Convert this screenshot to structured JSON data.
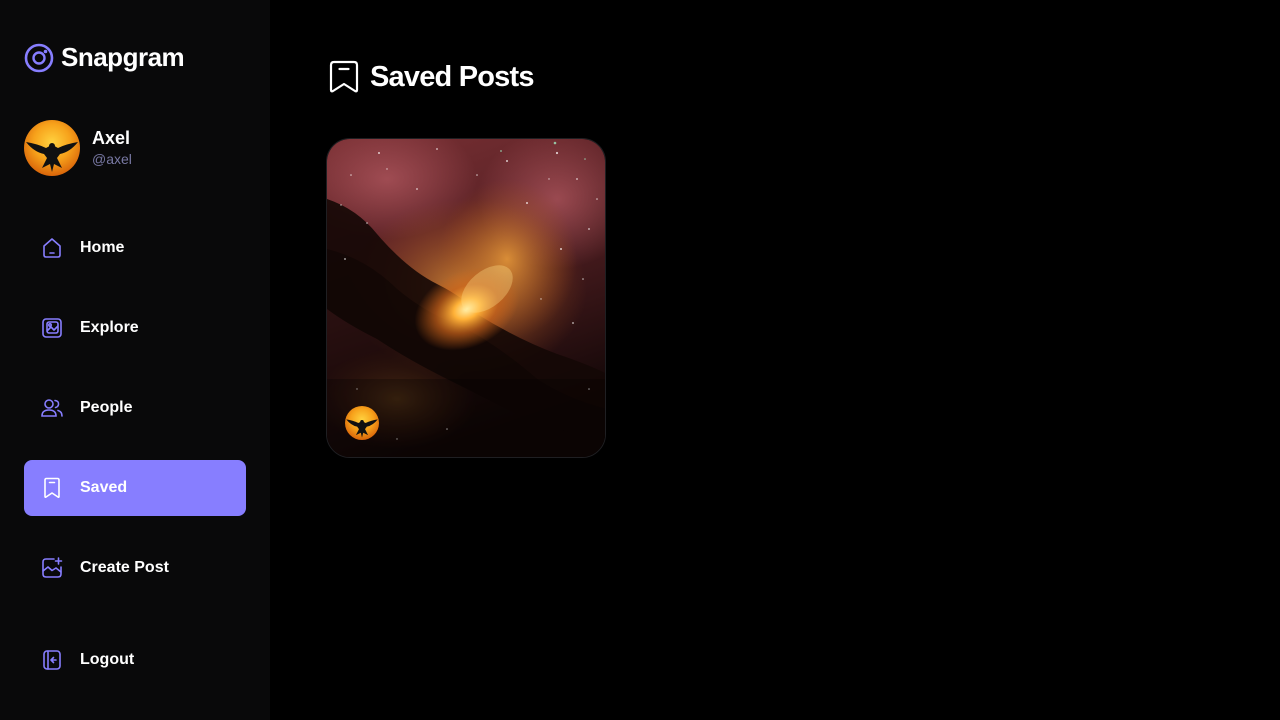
{
  "app": {
    "name": "Snapgram",
    "accent": "#877eff"
  },
  "user": {
    "name": "Axel",
    "handle": "@axel"
  },
  "nav": {
    "items": [
      {
        "label": "Home",
        "icon": "home-icon"
      },
      {
        "label": "Explore",
        "icon": "explore-icon"
      },
      {
        "label": "People",
        "icon": "people-icon"
      },
      {
        "label": "Saved",
        "icon": "bookmark-icon",
        "active": true
      },
      {
        "label": "Create Post",
        "icon": "create-post-icon"
      }
    ],
    "logout_label": "Logout"
  },
  "page": {
    "title": "Saved Posts",
    "icon": "bookmark-icon"
  },
  "saved_posts": [
    {
      "image": "nebula-image",
      "creator_avatar": "avatar"
    }
  ]
}
